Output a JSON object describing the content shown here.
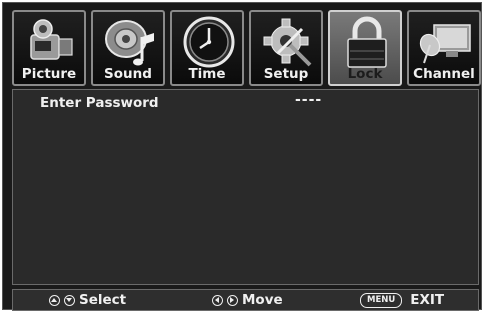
{
  "tabs": [
    {
      "label": "Picture",
      "icon": "camcorder-icon",
      "active": false
    },
    {
      "label": "Sound",
      "icon": "music-note-icon",
      "active": false
    },
    {
      "label": "Time",
      "icon": "clock-icon",
      "active": false
    },
    {
      "label": "Setup",
      "icon": "gear-wrench-icon",
      "active": false
    },
    {
      "label": "Lock",
      "icon": "padlock-icon",
      "active": true
    },
    {
      "label": "Channel",
      "icon": "satellite-dish-icon",
      "active": false
    }
  ],
  "password": {
    "label": "Enter Password",
    "value": "----"
  },
  "footer": {
    "select": {
      "icons": [
        "up-arrow-icon",
        "down-arrow-icon"
      ],
      "label": "Select"
    },
    "move": {
      "icons": [
        "left-arrow-icon",
        "right-arrow-icon"
      ],
      "label": "Move"
    },
    "exit": {
      "key": "MENU",
      "label": "EXIT"
    }
  },
  "colors": {
    "background": "#1a1a1a",
    "panel": "#2a2a2a",
    "active_tab": "#6a6a6a",
    "text": "#f0f0f0"
  }
}
